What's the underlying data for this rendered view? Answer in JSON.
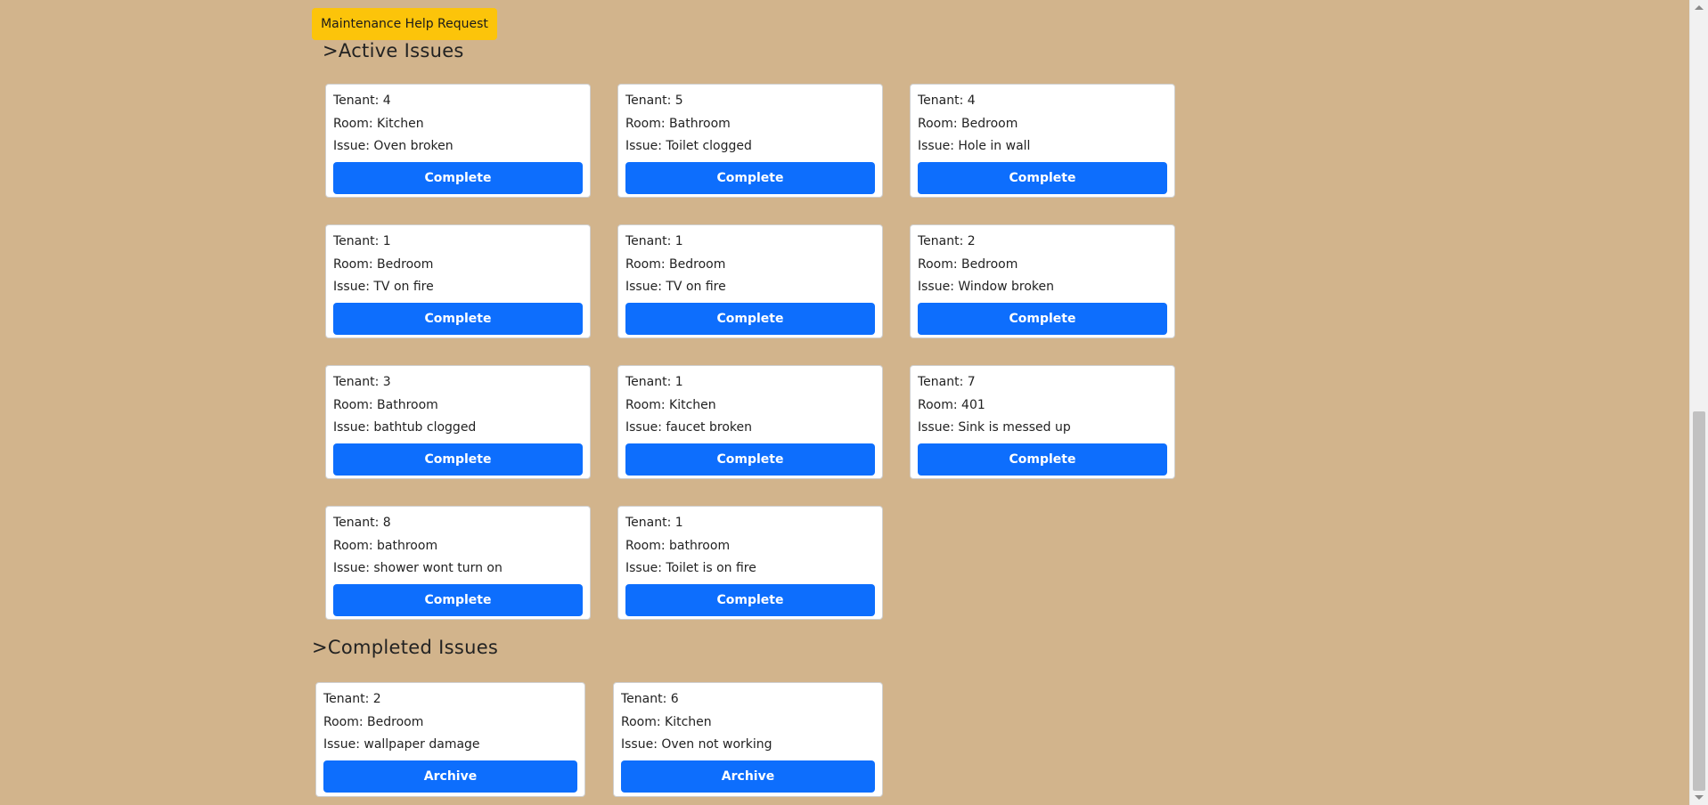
{
  "header": {
    "help_button_label": "Maintenance Help Request"
  },
  "active": {
    "title": ">Active Issues",
    "cards": [
      {
        "tenant": "Tenant: 4",
        "room": "Room: Kitchen",
        "issue": "Issue: Oven broken",
        "button": "Complete"
      },
      {
        "tenant": "Tenant: 5",
        "room": "Room: Bathroom",
        "issue": "Issue: Toilet clogged",
        "button": "Complete"
      },
      {
        "tenant": "Tenant: 4",
        "room": "Room: Bedroom",
        "issue": "Issue: Hole in wall",
        "button": "Complete"
      },
      {
        "tenant": "Tenant: 1",
        "room": "Room: Bedroom",
        "issue": "Issue: TV on fire",
        "button": "Complete"
      },
      {
        "tenant": "Tenant: 1",
        "room": "Room: Bedroom",
        "issue": "Issue: TV on fire",
        "button": "Complete"
      },
      {
        "tenant": "Tenant: 2",
        "room": "Room: Bedroom",
        "issue": "Issue: Window broken",
        "button": "Complete"
      },
      {
        "tenant": "Tenant: 3",
        "room": "Room: Bathroom",
        "issue": "Issue: bathtub clogged",
        "button": "Complete"
      },
      {
        "tenant": "Tenant: 1",
        "room": "Room: Kitchen",
        "issue": "Issue: faucet broken",
        "button": "Complete"
      },
      {
        "tenant": "Tenant: 7",
        "room": "Room: 401",
        "issue": "Issue: Sink is messed up",
        "button": "Complete"
      },
      {
        "tenant": "Tenant: 8",
        "room": "Room: bathroom",
        "issue": "Issue: shower wont turn on",
        "button": "Complete"
      },
      {
        "tenant": "Tenant: 1",
        "room": "Room: bathroom",
        "issue": "Issue: Toilet is on fire",
        "button": "Complete"
      }
    ]
  },
  "completed": {
    "title": ">Completed Issues",
    "cards": [
      {
        "tenant": "Tenant: 2",
        "room": "Room: Bedroom",
        "issue": "Issue: wallpaper damage",
        "button": "Archive"
      },
      {
        "tenant": "Tenant: 6",
        "room": "Room: Kitchen",
        "issue": "Issue: Oven not working",
        "button": "Archive"
      }
    ]
  },
  "colors": {
    "page_background": "#d2b48c",
    "help_button": "#fcc40a",
    "action_button": "#0d6efd"
  }
}
